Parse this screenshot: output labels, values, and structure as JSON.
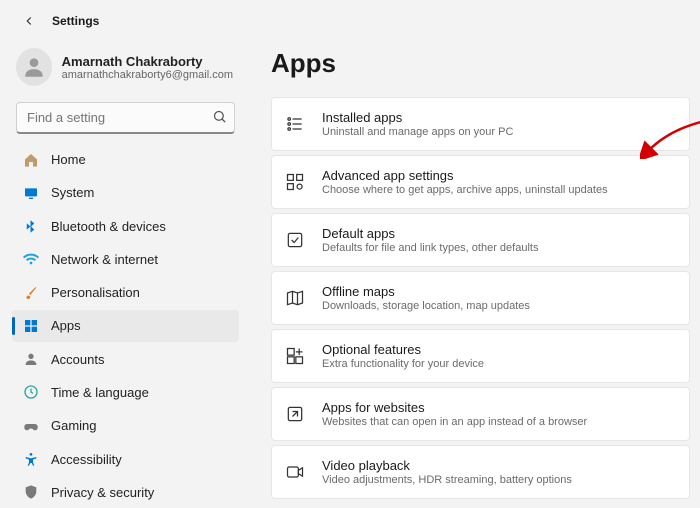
{
  "header": {
    "title": "Settings"
  },
  "profile": {
    "name": "Amarnath Chakraborty",
    "email": "amarnathchakraborty6@gmail.com"
  },
  "search": {
    "placeholder": "Find a setting"
  },
  "sidebar": {
    "items": [
      {
        "label": "Home"
      },
      {
        "label": "System"
      },
      {
        "label": "Bluetooth & devices"
      },
      {
        "label": "Network & internet"
      },
      {
        "label": "Personalisation"
      },
      {
        "label": "Apps"
      },
      {
        "label": "Accounts"
      },
      {
        "label": "Time & language"
      },
      {
        "label": "Gaming"
      },
      {
        "label": "Accessibility"
      },
      {
        "label": "Privacy & security"
      }
    ]
  },
  "page": {
    "title": "Apps"
  },
  "cards": [
    {
      "title": "Installed apps",
      "sub": "Uninstall and manage apps on your PC"
    },
    {
      "title": "Advanced app settings",
      "sub": "Choose where to get apps, archive apps, uninstall updates"
    },
    {
      "title": "Default apps",
      "sub": "Defaults for file and link types, other defaults"
    },
    {
      "title": "Offline maps",
      "sub": "Downloads, storage location, map updates"
    },
    {
      "title": "Optional features",
      "sub": "Extra functionality for your device"
    },
    {
      "title": "Apps for websites",
      "sub": "Websites that can open in an app instead of a browser"
    },
    {
      "title": "Video playback",
      "sub": "Video adjustments, HDR streaming, battery options"
    }
  ]
}
